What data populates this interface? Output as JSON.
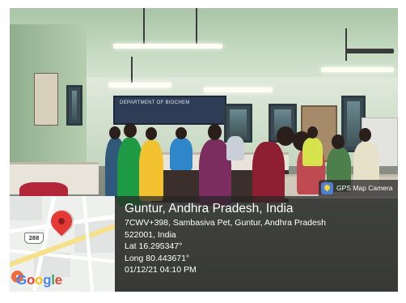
{
  "overlay": {
    "app_label": "GPS Map Camera",
    "app_icon": "map-pin-icon",
    "location_title": "Guntur, Andhra Pradesh, India",
    "address": "7CWV+398, Sambasiva Pet, Guntur, Andhra Pradesh",
    "postcode": "522001, India",
    "latitude": "Lat 16.295347°",
    "longitude": "Long 80.443671°",
    "datetime": "01/12/21 04:10 PM",
    "map": {
      "route_shield": "288",
      "marker_icon": "location-pin-icon",
      "brand": [
        "G",
        "o",
        "o",
        "g",
        "l",
        "e"
      ],
      "pin_color": "#e53935"
    }
  },
  "scene": {
    "board_text": "DEPARTMENT OF BIOCHEM"
  }
}
